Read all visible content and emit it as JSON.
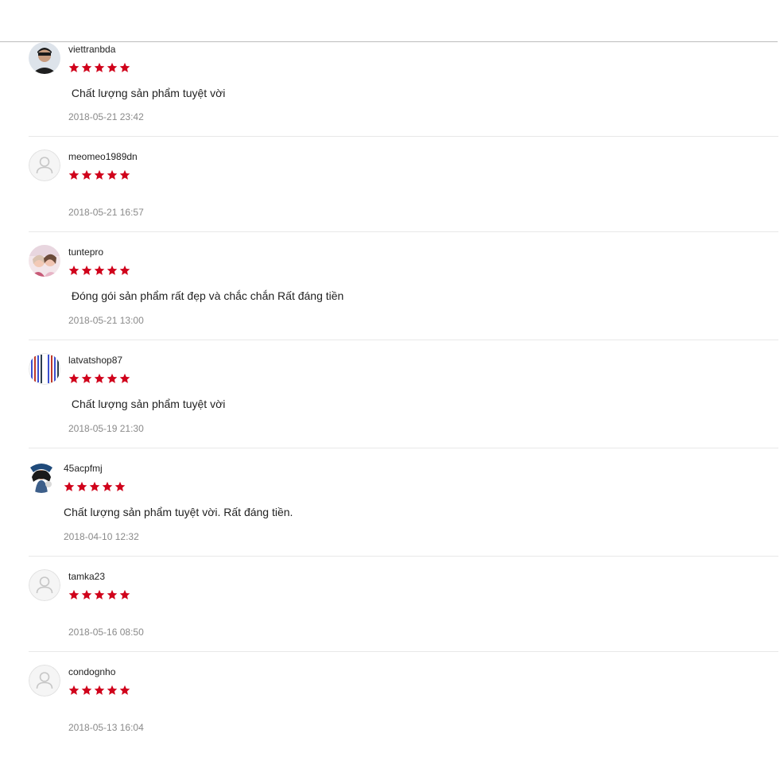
{
  "colors": {
    "star": "#d0021b",
    "date": "#8a8a8a",
    "divider": "#e8e8e8"
  },
  "reviews": [
    {
      "username": "viettranbda",
      "rating": 5,
      "comment": " Chất lượng sản phẩm tuyệt vời",
      "date": "2018-05-21 23:42",
      "avatar": "user-photo-icon"
    },
    {
      "username": "meomeo1989dn",
      "rating": 5,
      "comment": "",
      "date": "2018-05-21 16:57",
      "avatar": "default-user-icon"
    },
    {
      "username": "tuntepro",
      "rating": 5,
      "comment": " Đóng gói sản phẩm rất đẹp và chắc chắn Rất đáng tiền",
      "date": "2018-05-21 13:00",
      "avatar": "user-photo-icon"
    },
    {
      "username": "latvatshop87",
      "rating": 5,
      "comment": " Chất lượng sản phẩm tuyệt vời",
      "date": "2018-05-19 21:30",
      "avatar": "user-photo-icon"
    },
    {
      "username": "45acpfmj",
      "rating": 5,
      "comment": "Chất lượng sản phẩm tuyệt vời. Rất đáng tiền.",
      "date": "2018-04-10 12:32",
      "avatar": "user-photo-icon"
    },
    {
      "username": "tamka23",
      "rating": 5,
      "comment": "",
      "date": "2018-05-16 08:50",
      "avatar": "default-user-icon"
    },
    {
      "username": "condognho",
      "rating": 5,
      "comment": "",
      "date": "2018-05-13 16:04",
      "avatar": "default-user-icon"
    }
  ]
}
